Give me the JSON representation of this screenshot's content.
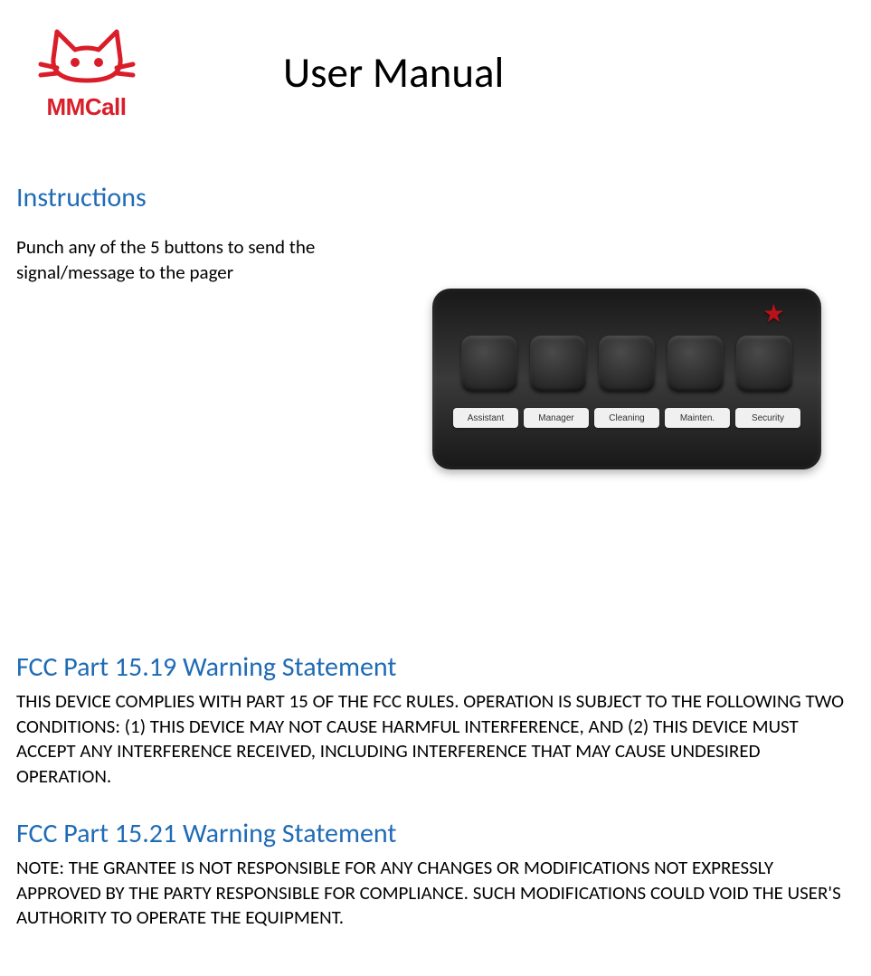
{
  "logo": {
    "brand": "MMCall"
  },
  "title": "User Manual",
  "instructions": {
    "heading": "Instructions",
    "body": "Punch any of the 5 buttons to send the signal/message to the pager"
  },
  "device": {
    "labels": [
      "Assistant",
      "Manager",
      "Cleaning",
      "Mainten.",
      "Security"
    ]
  },
  "fcc1": {
    "heading": "FCC Part 15.19 Warning Statement",
    "body": "THIS DEVICE COMPLIES WITH PART 15 OF THE FCC RULES. OPERATION IS SUBJECT TO THE FOLLOWING TWO CONDITIONS: (1) THIS DEVICE MAY NOT CAUSE HARMFUL INTERFERENCE, AND (2) THIS DEVICE MUST ACCEPT ANY INTERFERENCE RECEIVED, INCLUDING INTERFERENCE THAT MAY CAUSE UNDESIRED OPERATION."
  },
  "fcc2": {
    "heading": "FCC Part 15.21 Warning Statement",
    "body": "NOTE:   THE GRANTEE IS NOT RESPONSIBLE FOR ANY CHANGES OR MODIFICATIONS NOT EXPRESSLY APPROVED BY THE PARTY RESPONSIBLE FOR COMPLIANCE. SUCH MODIFICATIONS COULD VOID THE USER'S AUTHORITY TO OPERATE THE EQUIPMENT."
  }
}
